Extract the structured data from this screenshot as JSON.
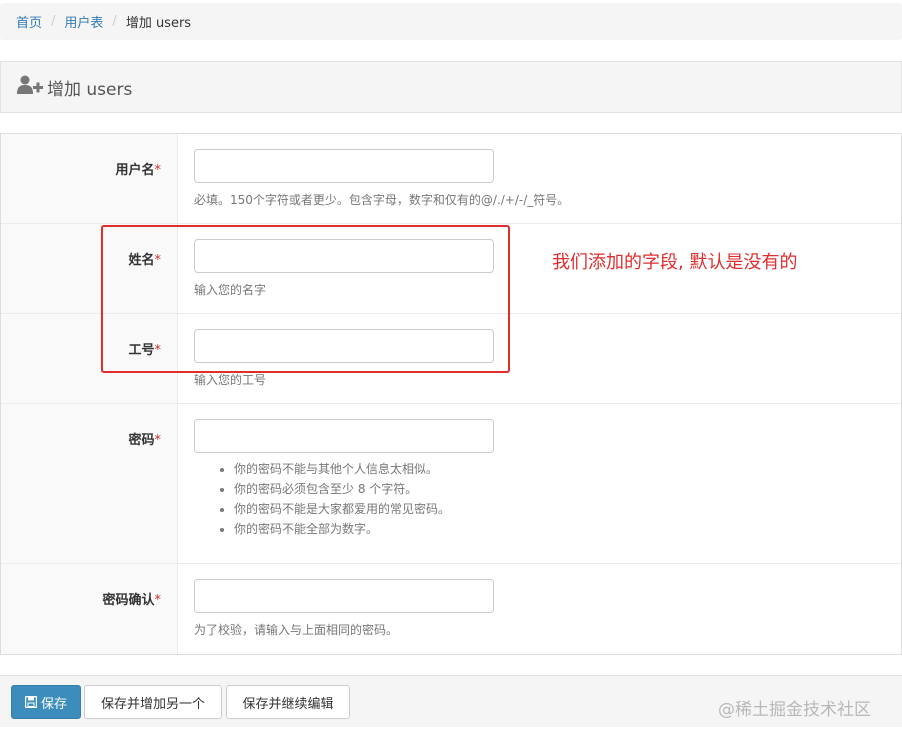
{
  "breadcrumb": {
    "home": "首页",
    "users_table": "用户表",
    "current": "增加 users"
  },
  "panel": {
    "title": "增加 users"
  },
  "fields": {
    "username": {
      "label": "用户名",
      "required": "*",
      "help": "必填。150个字符或者更少。包含字母，数字和仅有的@/./+/-/_符号。"
    },
    "name": {
      "label": "姓名",
      "required": "*",
      "help": "输入您的名字"
    },
    "employee_id": {
      "label": "工号",
      "required": "*",
      "help": "输入您的工号"
    },
    "password": {
      "label": "密码",
      "required": "*",
      "help_items": [
        "你的密码不能与其他个人信息太相似。",
        "你的密码必须包含至少 8 个字符。",
        "你的密码不能是大家都爱用的常见密码。",
        "你的密码不能全部为数字。"
      ]
    },
    "password_confirm": {
      "label": "密码确认",
      "required": "*",
      "help": "为了校验，请输入与上面相同的密码。"
    }
  },
  "annotation": {
    "note": "我们添加的字段, 默认是没有的",
    "color": "#e02d2d"
  },
  "buttons": {
    "save": "保存",
    "save_add_another": "保存并增加另一个",
    "save_continue": "保存并继续编辑"
  },
  "watermark": "@稀土掘金技术社区",
  "colors": {
    "primary": "#3c8dbc",
    "link": "#337ab7",
    "required": "#c9302c"
  }
}
